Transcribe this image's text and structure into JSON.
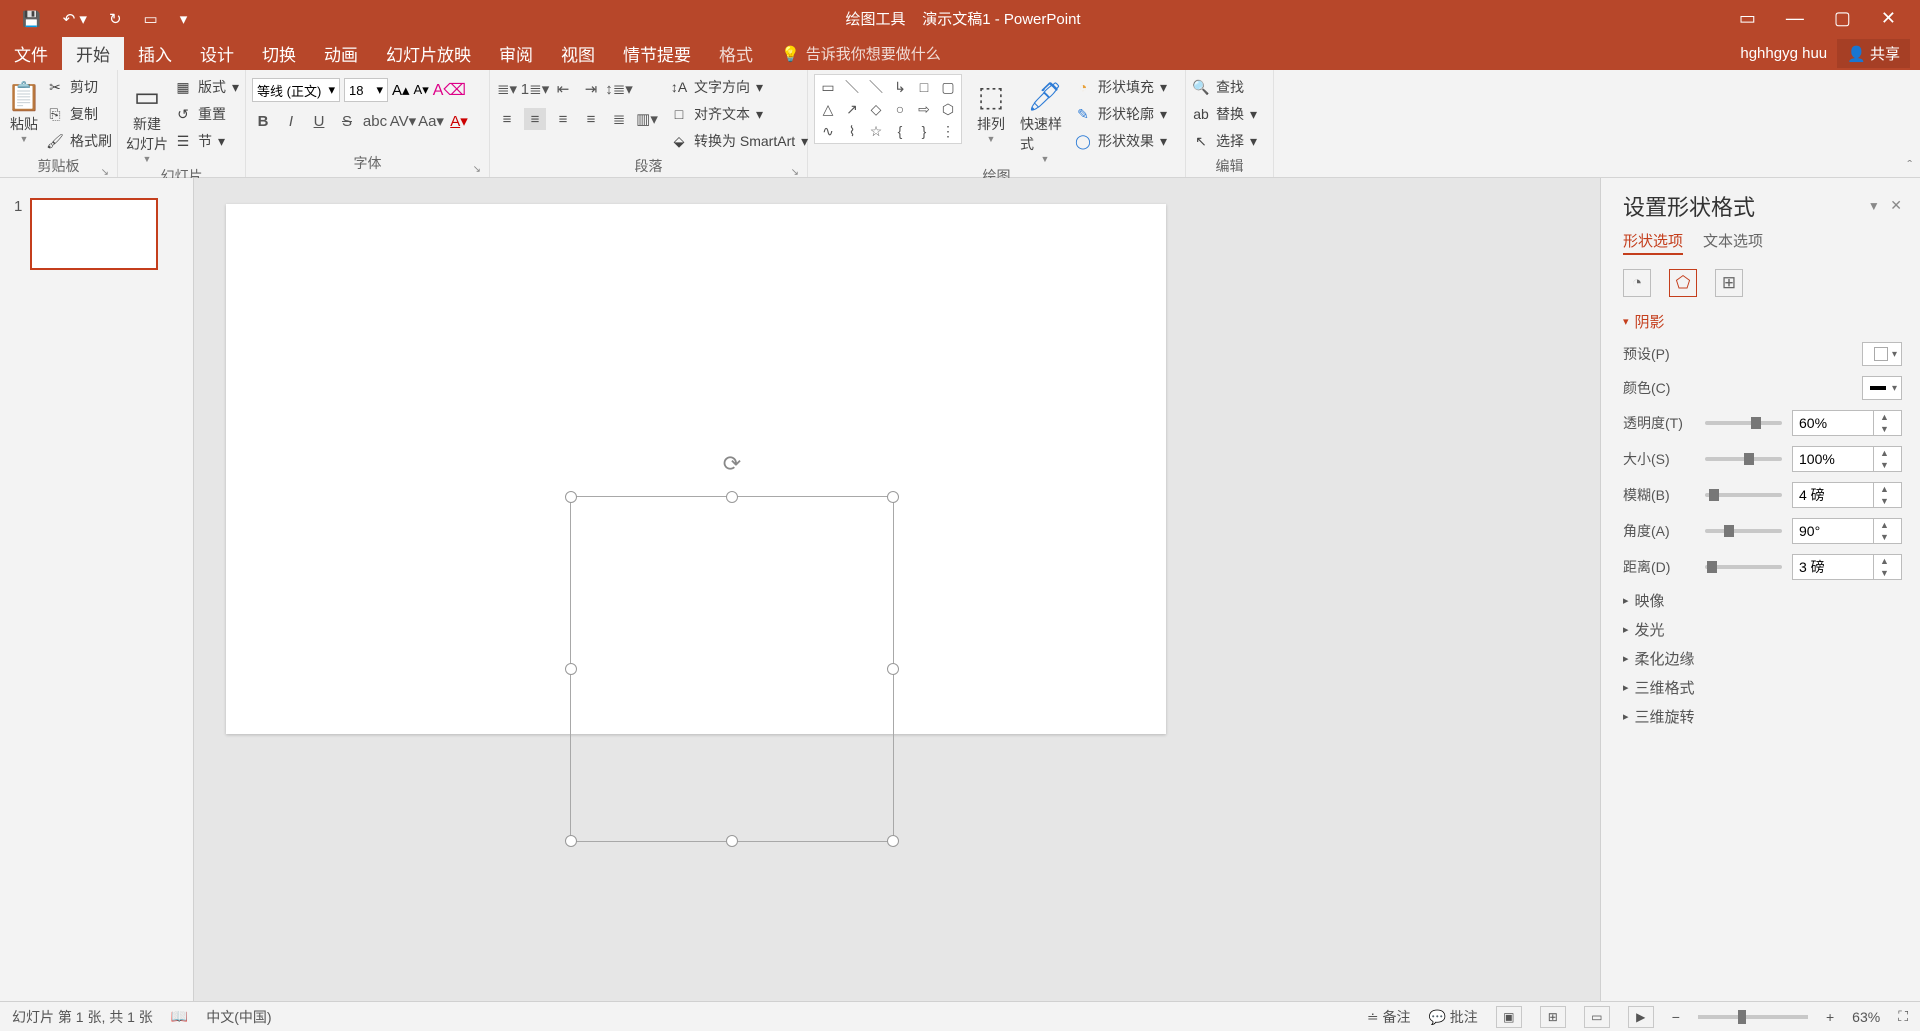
{
  "titlebar": {
    "tool_context": "绘图工具",
    "doc_title": "演示文稿1 - PowerPoint"
  },
  "menubar": {
    "tabs": [
      "文件",
      "开始",
      "插入",
      "设计",
      "切换",
      "动画",
      "幻灯片放映",
      "审阅",
      "视图",
      "情节提要",
      "格式"
    ],
    "active": "开始",
    "tell_me": "告诉我你想要做什么",
    "user": "hghhgyg huu",
    "share": "共享"
  },
  "ribbon": {
    "clipboard": {
      "label": "剪贴板",
      "paste": "粘贴",
      "cut": "剪切",
      "copy": "复制",
      "format_painter": "格式刷"
    },
    "slides": {
      "label": "幻灯片",
      "new_slide": "新建\n幻灯片",
      "layout": "版式",
      "reset": "重置",
      "section": "节"
    },
    "font": {
      "label": "字体",
      "name": "等线 (正文)",
      "size": "18"
    },
    "paragraph": {
      "label": "段落",
      "text_dir": "文字方向",
      "align_text": "对齐文本",
      "smartart": "转换为 SmartArt"
    },
    "drawing": {
      "label": "绘图",
      "arrange": "排列",
      "quick_styles": "快速样式",
      "fill": "形状填充",
      "outline": "形状轮廓",
      "effects": "形状效果"
    },
    "editing": {
      "label": "编辑",
      "find": "查找",
      "replace": "替换",
      "select": "选择"
    }
  },
  "thumb": {
    "num": "1"
  },
  "pane": {
    "title": "设置形状格式",
    "tab_shape": "形状选项",
    "tab_text": "文本选项",
    "shadow": "阴影",
    "preset": "预设(P)",
    "color": "颜色(C)",
    "transparency": "透明度(T)",
    "transparency_v": "60%",
    "size": "大小(S)",
    "size_v": "100%",
    "blur": "模糊(B)",
    "blur_v": "4 磅",
    "angle": "角度(A)",
    "angle_v": "90°",
    "distance": "距离(D)",
    "distance_v": "3 磅",
    "reflection": "映像",
    "glow": "发光",
    "soft_edges": "柔化边缘",
    "format_3d": "三维格式",
    "rotate_3d": "三维旋转"
  },
  "status": {
    "slide_info": "幻灯片 第 1 张, 共 1 张",
    "lang": "中文(中国)",
    "notes": "备注",
    "comments": "批注",
    "zoom": "63%"
  }
}
